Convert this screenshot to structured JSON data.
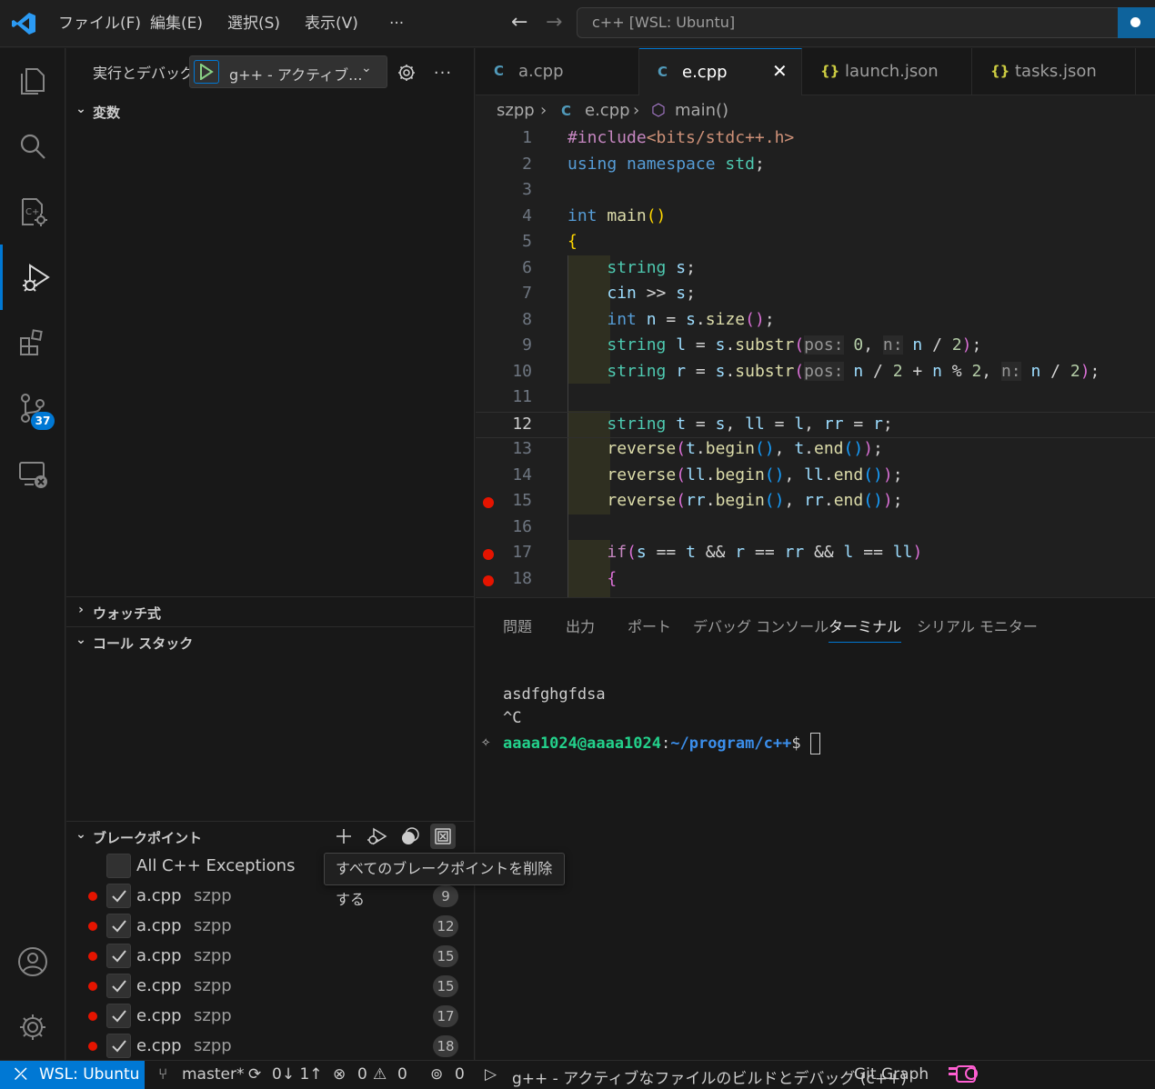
{
  "titlebar": {
    "menus": [
      "ファイル(F)",
      "編集(E)",
      "選択(S)",
      "表示(V)",
      "···"
    ],
    "command_center": "c++ [WSL: Ubuntu]"
  },
  "activitybar": {
    "items": [
      "explorer-icon",
      "search-icon",
      "cpp-icon",
      "run-debug-icon",
      "extensions-icon",
      "source-control-icon",
      "remote-explorer-icon",
      "account-icon",
      "settings-icon"
    ],
    "scm_badge": "37",
    "accent": "#0078d4"
  },
  "sidebar": {
    "title": "実行とデバッグ",
    "config_label": "g++ - アクティブ...",
    "sections": {
      "variables": "変数",
      "watch": "ウォッチ式",
      "callstack": "コール スタック",
      "breakpoints": "ブレークポイント"
    },
    "exceptions_label": "All C++ Exceptions",
    "breakpoints": [
      {
        "file": "a.cpp",
        "folder": "szpp",
        "line": "9"
      },
      {
        "file": "a.cpp",
        "folder": "szpp",
        "line": "12"
      },
      {
        "file": "a.cpp",
        "folder": "szpp",
        "line": "15"
      },
      {
        "file": "e.cpp",
        "folder": "szpp",
        "line": "15"
      },
      {
        "file": "e.cpp",
        "folder": "szpp",
        "line": "17"
      },
      {
        "file": "e.cpp",
        "folder": "szpp",
        "line": "18"
      }
    ],
    "tooltip": "すべてのブレークポイントを削除する"
  },
  "editor": {
    "tabs": [
      {
        "label": "a.cpp",
        "icon": "C"
      },
      {
        "label": "e.cpp",
        "icon": "C"
      },
      {
        "label": "launch.json",
        "icon": "{}"
      },
      {
        "label": "tasks.json",
        "icon": "{}"
      }
    ],
    "breadcrumb": [
      "szpp",
      "e.cpp",
      "main()"
    ],
    "line_numbers": [
      "1",
      "2",
      "3",
      "4",
      "5",
      "6",
      "7",
      "8",
      "9",
      "10",
      "11",
      "12",
      "13",
      "14",
      "15",
      "16",
      "17",
      "18"
    ],
    "current_line": "12",
    "breakpoint_lines": [
      "15",
      "17",
      "18"
    ]
  },
  "panel": {
    "tabs": [
      "問題",
      "出力",
      "ポート",
      "デバッグ コンソール",
      "ターミナル",
      "シリアル モニター"
    ],
    "active_tab": "ターミナル",
    "terminal": {
      "lines": [
        "asdfghgfdsa",
        "^C"
      ],
      "prompt_user": "aaaa1024@aaaa1024",
      "prompt_path": "~/program/c++",
      "prompt_suffix": "$"
    }
  },
  "statusbar": {
    "remote": "WSL: Ubuntu",
    "branch": "master*",
    "sync": "0↓ 1↑",
    "errors": "0",
    "warnings": "0",
    "ports": "0",
    "debug_config": "g++ - アクティブなファイルのビルドとデバッグ (c++)",
    "git_graph": "Git Graph"
  }
}
